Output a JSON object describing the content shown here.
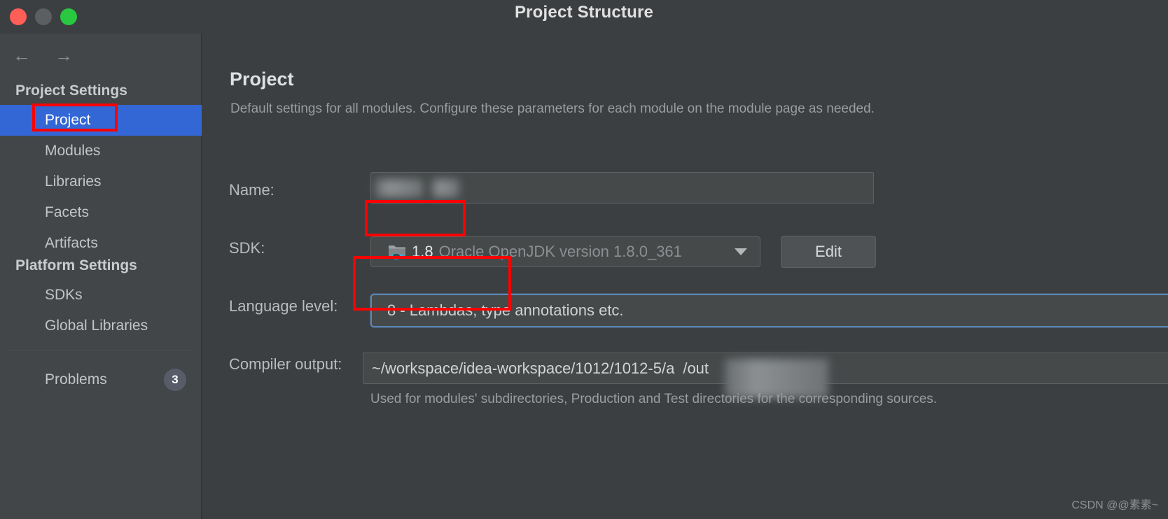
{
  "window": {
    "title": "Project Structure",
    "traffic_lights": [
      "close-button",
      "minimize-button",
      "maximize-button"
    ]
  },
  "sidebar": {
    "back_icon": "←",
    "forward_icon": "→",
    "sections": [
      {
        "title": "Project Settings",
        "items": [
          {
            "label": "Project",
            "selected": true
          },
          {
            "label": "Modules",
            "selected": false
          },
          {
            "label": "Libraries",
            "selected": false
          },
          {
            "label": "Facets",
            "selected": false
          },
          {
            "label": "Artifacts",
            "selected": false
          }
        ]
      },
      {
        "title": "Platform Settings",
        "items": [
          {
            "label": "SDKs",
            "selected": false
          },
          {
            "label": "Global Libraries",
            "selected": false
          }
        ]
      }
    ],
    "problems": {
      "label": "Problems",
      "count": "3"
    }
  },
  "main": {
    "title": "Project",
    "description": "Default settings for all modules. Configure these parameters for each module on the module page as needed.",
    "fields": {
      "name": {
        "label": "Name:",
        "value": "",
        "redacted": true
      },
      "sdk": {
        "label": "SDK:",
        "version": "1.8",
        "detail": "Oracle OpenJDK version 1.8.0_361",
        "icon": "jdk-folder-icon",
        "edit_button": "Edit"
      },
      "language_level": {
        "label": "Language level:",
        "value": "8 - Lambdas, type annotations etc.",
        "focused": true
      },
      "compiler_output": {
        "label": "Compiler output:",
        "value_prefix": "~/workspace/idea-workspace/1012/1012-5/a",
        "value_suffix": "/out",
        "redacted_middle": true,
        "hint": "Used for modules' subdirectories, Production and Test directories for the corresponding sources.",
        "browse_icon": "folder-icon"
      }
    }
  },
  "annotations": {
    "highlight_color": "#ff0000",
    "boxes": [
      "project-nav-item",
      "sdk-version-icon",
      "language-level-start"
    ]
  },
  "watermark": "CSDN @@素素~",
  "colors": {
    "accent_selected": "#3367d6",
    "focus_ring": "#5b87b5",
    "window_bg": "#3c3f41",
    "sidebar_bg": "#434649"
  }
}
